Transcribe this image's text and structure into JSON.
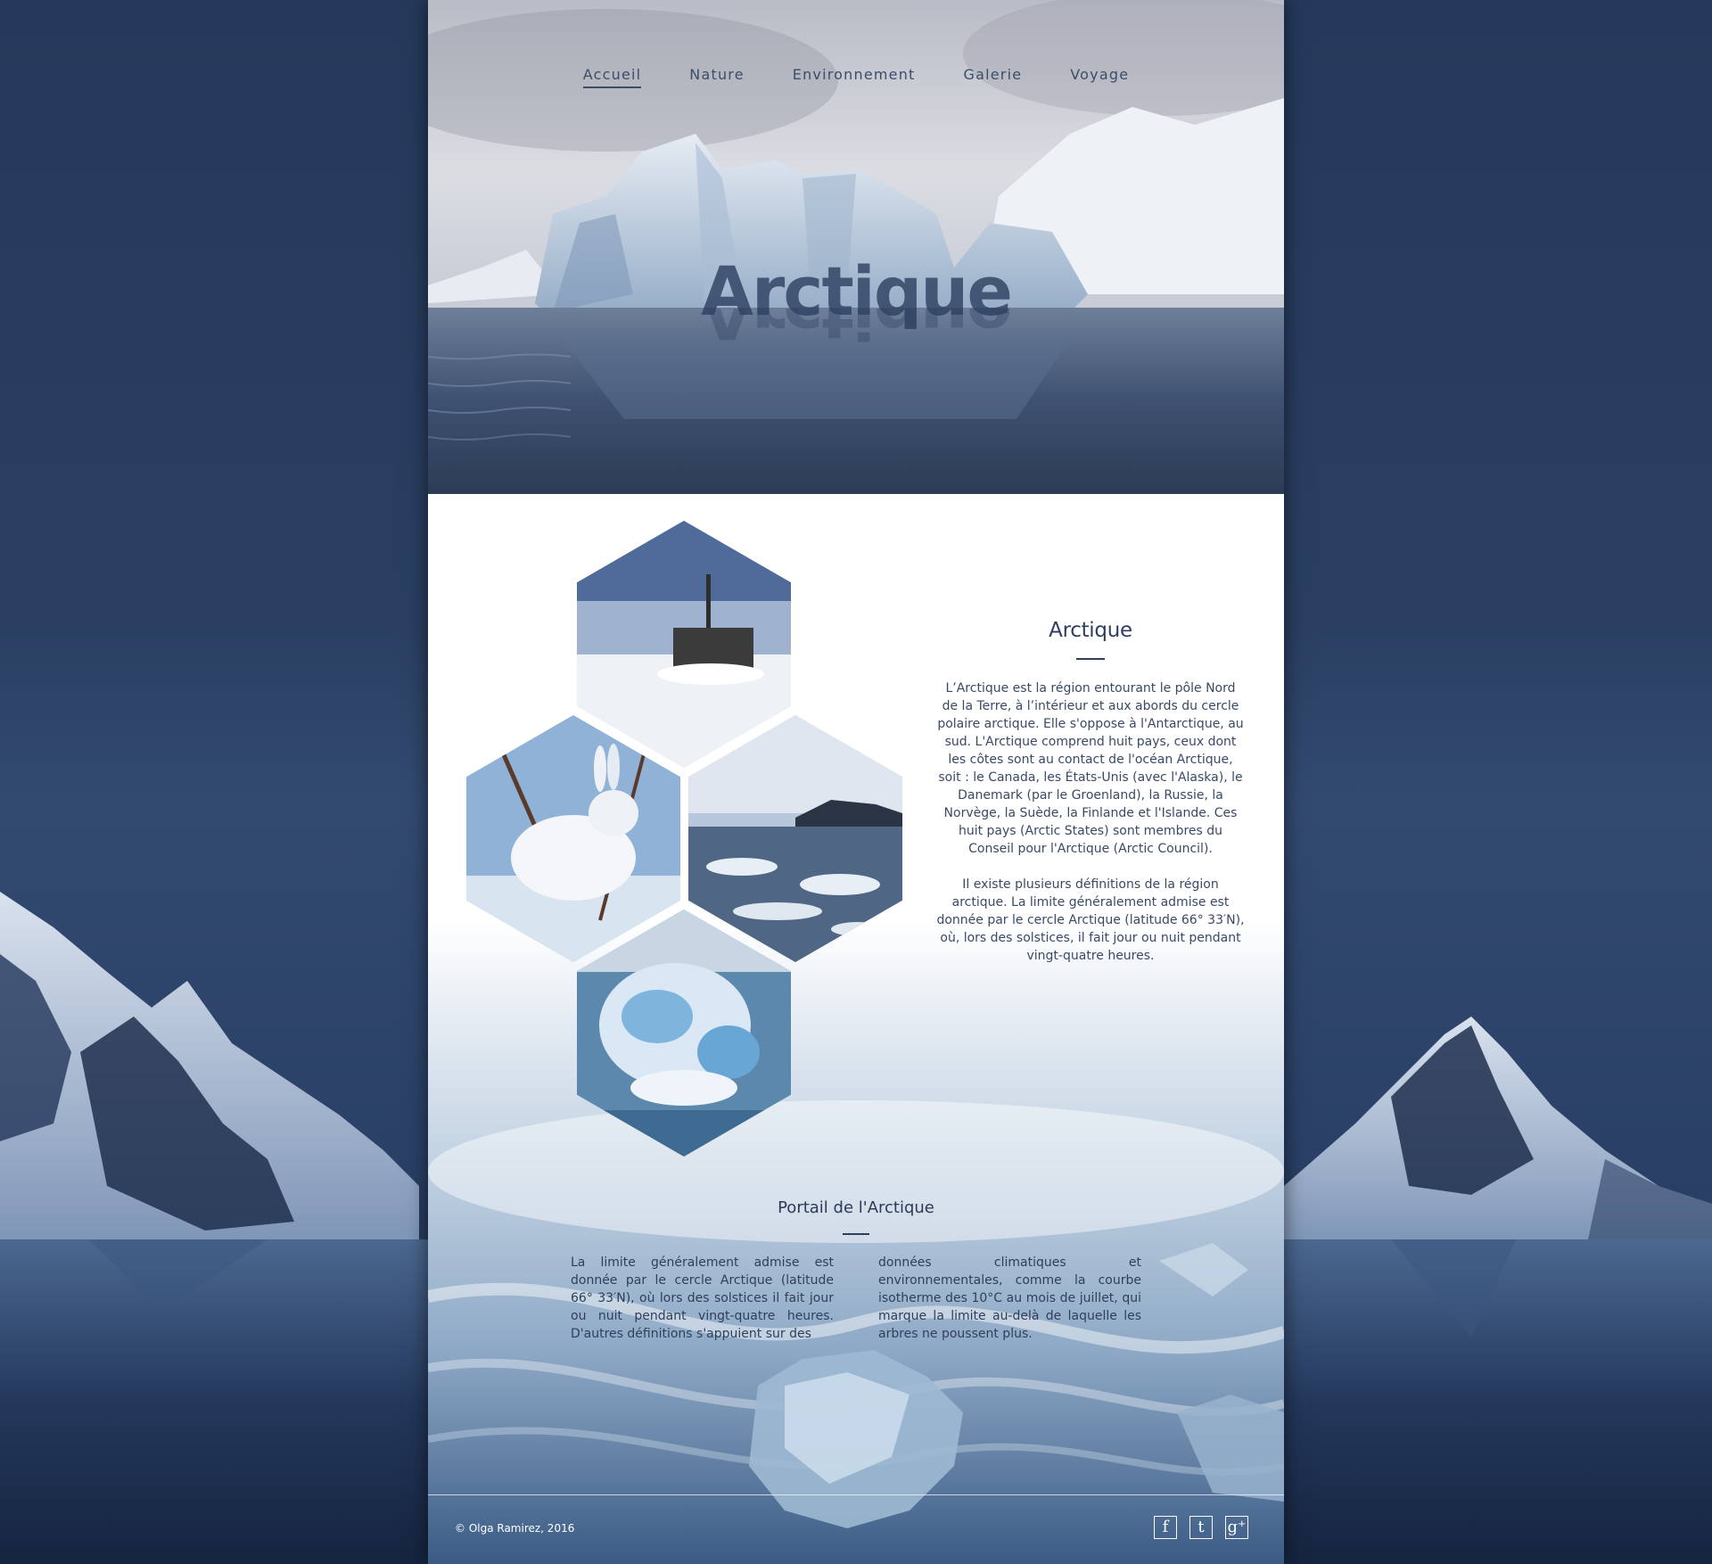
{
  "nav": {
    "items": [
      {
        "label": "Accueil",
        "active": true
      },
      {
        "label": "Nature",
        "active": false
      },
      {
        "label": "Environnement",
        "active": false
      },
      {
        "label": "Galerie",
        "active": false
      },
      {
        "label": "Voyage",
        "active": false
      }
    ]
  },
  "hero": {
    "title": "Arctique"
  },
  "gallery": {
    "images": [
      {
        "icon": "submarine-image"
      },
      {
        "icon": "arctic-hare-image"
      },
      {
        "icon": "sea-ice-image"
      },
      {
        "icon": "blue-ice-image"
      }
    ]
  },
  "about": {
    "title": "Arctique",
    "paragraphs": [
      "L’Arctique est la région entourant le pôle Nord de la Terre, à l’intérieur et aux abords du cercle polaire arctique. Elle s'oppose à l'Antarctique, au sud. L'Arctique comprend huit pays, ceux dont les côtes sont au contact de l'océan Arctique, soit : le Canada, les États-Unis (avec l'Alaska), le Danemark (par le Groenland), la Russie, la Norvège, la Suède, la Finlande et l'Islande. Ces huit pays (Arctic States) sont membres du Conseil pour l'Arctique (Arctic Council).",
      "Il existe plusieurs définitions de la région arctique. La limite généralement admise est donnée par le cercle Arctique (latitude 66° 33′N), où, lors des solstices, il fait jour ou nuit pendant vingt-quatre heures."
    ]
  },
  "portal": {
    "title": "Portail de l'Arctique",
    "col1": "La limite généralement admise est donnée par le cercle Arctique (latitude 66° 33′N), où lors des solstices il fait jour ou nuit pendant vingt-quatre heures. D'autres définitions s'appuient sur des",
    "col2": "données climatiques et environnementales, comme la courbe isotherme des 10°C au mois de juillet, qui marque la limite au-delà de laquelle les arbres ne poussent plus."
  },
  "footer": {
    "copyright": "© Olga Ramirez, 2016",
    "socials": [
      {
        "icon": "facebook-icon",
        "glyph": "f"
      },
      {
        "icon": "tumblr-icon",
        "glyph": "t"
      },
      {
        "icon": "google-plus-icon",
        "glyph": "g⁺"
      }
    ]
  },
  "colors": {
    "accent": "#2e3f5e",
    "background": "#25395c",
    "text": "#3a4a66"
  }
}
